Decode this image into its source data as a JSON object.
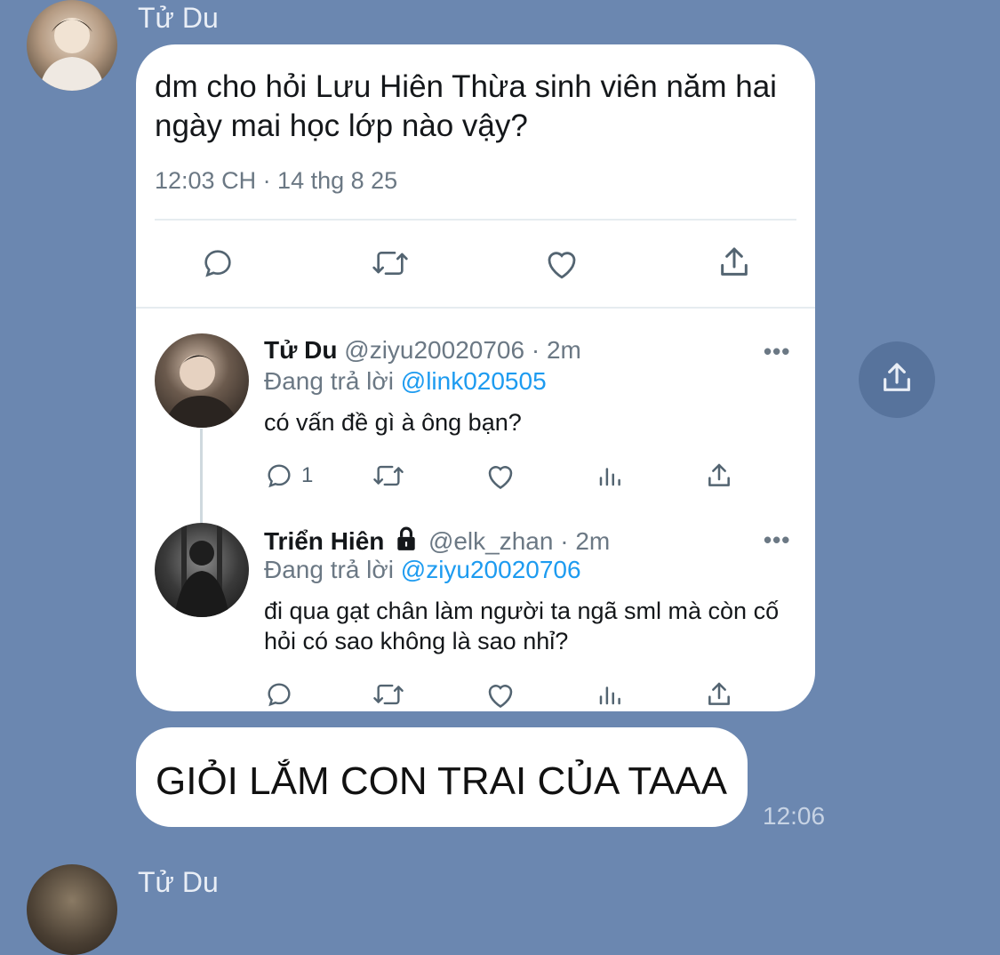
{
  "chat": {
    "sender_name": "Tử Du",
    "next_sender_name": "Tử Du",
    "message_text": "GIỎI LẮM CON TRAI CỦA TAAA",
    "message_time": "12:06"
  },
  "tweet": {
    "text": "dm cho hỏi Lưu Hiên Thừa sinh viên năm hai ngày mai học lớp nào vậy?",
    "meta": "12:03 CH · 14 thg 8 25"
  },
  "replies": [
    {
      "name": "Tử Du",
      "handle": "@ziyu20020706",
      "time": "· 2m",
      "replying_prefix": "Đang trả lời",
      "replying_to": "@link020505",
      "text": "có vấn đề gì à ông bạn?",
      "reply_count": "1"
    },
    {
      "name": "Triển Hiên",
      "handle": "@elk_zhan",
      "time": "· 2m",
      "replying_prefix": "Đang trả lời",
      "replying_to": "@ziyu20020706",
      "text": "đi qua gạt chân làm người ta ngã sml mà còn cố hỏi có sao không là sao nhỉ?",
      "reply_count": ""
    }
  ],
  "icons": {
    "reply": "comment-icon",
    "retweet": "retweet-icon",
    "like": "heart-icon",
    "share": "share-icon",
    "views": "analytics-icon",
    "more": "more-icon",
    "lock": "lock-icon"
  },
  "colors": {
    "background": "#6b87b0",
    "link": "#1d9bf0"
  }
}
